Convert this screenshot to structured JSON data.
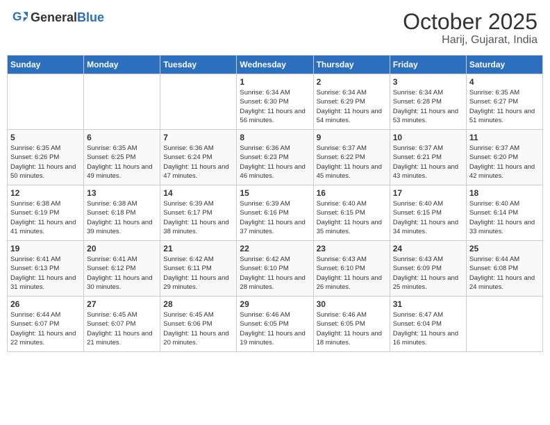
{
  "header": {
    "logo_general": "General",
    "logo_blue": "Blue",
    "main_title": "October 2025",
    "sub_title": "Harij, Gujarat, India"
  },
  "days_of_week": [
    "Sunday",
    "Monday",
    "Tuesday",
    "Wednesday",
    "Thursday",
    "Friday",
    "Saturday"
  ],
  "weeks": [
    [
      {
        "date": "",
        "sunrise": "",
        "sunset": "",
        "daylight": ""
      },
      {
        "date": "",
        "sunrise": "",
        "sunset": "",
        "daylight": ""
      },
      {
        "date": "",
        "sunrise": "",
        "sunset": "",
        "daylight": ""
      },
      {
        "date": "1",
        "sunrise": "Sunrise: 6:34 AM",
        "sunset": "Sunset: 6:30 PM",
        "daylight": "Daylight: 11 hours and 56 minutes."
      },
      {
        "date": "2",
        "sunrise": "Sunrise: 6:34 AM",
        "sunset": "Sunset: 6:29 PM",
        "daylight": "Daylight: 11 hours and 54 minutes."
      },
      {
        "date": "3",
        "sunrise": "Sunrise: 6:34 AM",
        "sunset": "Sunset: 6:28 PM",
        "daylight": "Daylight: 11 hours and 53 minutes."
      },
      {
        "date": "4",
        "sunrise": "Sunrise: 6:35 AM",
        "sunset": "Sunset: 6:27 PM",
        "daylight": "Daylight: 11 hours and 51 minutes."
      }
    ],
    [
      {
        "date": "5",
        "sunrise": "Sunrise: 6:35 AM",
        "sunset": "Sunset: 6:26 PM",
        "daylight": "Daylight: 11 hours and 50 minutes."
      },
      {
        "date": "6",
        "sunrise": "Sunrise: 6:35 AM",
        "sunset": "Sunset: 6:25 PM",
        "daylight": "Daylight: 11 hours and 49 minutes."
      },
      {
        "date": "7",
        "sunrise": "Sunrise: 6:36 AM",
        "sunset": "Sunset: 6:24 PM",
        "daylight": "Daylight: 11 hours and 47 minutes."
      },
      {
        "date": "8",
        "sunrise": "Sunrise: 6:36 AM",
        "sunset": "Sunset: 6:23 PM",
        "daylight": "Daylight: 11 hours and 46 minutes."
      },
      {
        "date": "9",
        "sunrise": "Sunrise: 6:37 AM",
        "sunset": "Sunset: 6:22 PM",
        "daylight": "Daylight: 11 hours and 45 minutes."
      },
      {
        "date": "10",
        "sunrise": "Sunrise: 6:37 AM",
        "sunset": "Sunset: 6:21 PM",
        "daylight": "Daylight: 11 hours and 43 minutes."
      },
      {
        "date": "11",
        "sunrise": "Sunrise: 6:37 AM",
        "sunset": "Sunset: 6:20 PM",
        "daylight": "Daylight: 11 hours and 42 minutes."
      }
    ],
    [
      {
        "date": "12",
        "sunrise": "Sunrise: 6:38 AM",
        "sunset": "Sunset: 6:19 PM",
        "daylight": "Daylight: 11 hours and 41 minutes."
      },
      {
        "date": "13",
        "sunrise": "Sunrise: 6:38 AM",
        "sunset": "Sunset: 6:18 PM",
        "daylight": "Daylight: 11 hours and 39 minutes."
      },
      {
        "date": "14",
        "sunrise": "Sunrise: 6:39 AM",
        "sunset": "Sunset: 6:17 PM",
        "daylight": "Daylight: 11 hours and 38 minutes."
      },
      {
        "date": "15",
        "sunrise": "Sunrise: 6:39 AM",
        "sunset": "Sunset: 6:16 PM",
        "daylight": "Daylight: 11 hours and 37 minutes."
      },
      {
        "date": "16",
        "sunrise": "Sunrise: 6:40 AM",
        "sunset": "Sunset: 6:15 PM",
        "daylight": "Daylight: 11 hours and 35 minutes."
      },
      {
        "date": "17",
        "sunrise": "Sunrise: 6:40 AM",
        "sunset": "Sunset: 6:15 PM",
        "daylight": "Daylight: 11 hours and 34 minutes."
      },
      {
        "date": "18",
        "sunrise": "Sunrise: 6:40 AM",
        "sunset": "Sunset: 6:14 PM",
        "daylight": "Daylight: 11 hours and 33 minutes."
      }
    ],
    [
      {
        "date": "19",
        "sunrise": "Sunrise: 6:41 AM",
        "sunset": "Sunset: 6:13 PM",
        "daylight": "Daylight: 11 hours and 31 minutes."
      },
      {
        "date": "20",
        "sunrise": "Sunrise: 6:41 AM",
        "sunset": "Sunset: 6:12 PM",
        "daylight": "Daylight: 11 hours and 30 minutes."
      },
      {
        "date": "21",
        "sunrise": "Sunrise: 6:42 AM",
        "sunset": "Sunset: 6:11 PM",
        "daylight": "Daylight: 11 hours and 29 minutes."
      },
      {
        "date": "22",
        "sunrise": "Sunrise: 6:42 AM",
        "sunset": "Sunset: 6:10 PM",
        "daylight": "Daylight: 11 hours and 28 minutes."
      },
      {
        "date": "23",
        "sunrise": "Sunrise: 6:43 AM",
        "sunset": "Sunset: 6:10 PM",
        "daylight": "Daylight: 11 hours and 26 minutes."
      },
      {
        "date": "24",
        "sunrise": "Sunrise: 6:43 AM",
        "sunset": "Sunset: 6:09 PM",
        "daylight": "Daylight: 11 hours and 25 minutes."
      },
      {
        "date": "25",
        "sunrise": "Sunrise: 6:44 AM",
        "sunset": "Sunset: 6:08 PM",
        "daylight": "Daylight: 11 hours and 24 minutes."
      }
    ],
    [
      {
        "date": "26",
        "sunrise": "Sunrise: 6:44 AM",
        "sunset": "Sunset: 6:07 PM",
        "daylight": "Daylight: 11 hours and 22 minutes."
      },
      {
        "date": "27",
        "sunrise": "Sunrise: 6:45 AM",
        "sunset": "Sunset: 6:07 PM",
        "daylight": "Daylight: 11 hours and 21 minutes."
      },
      {
        "date": "28",
        "sunrise": "Sunrise: 6:45 AM",
        "sunset": "Sunset: 6:06 PM",
        "daylight": "Daylight: 11 hours and 20 minutes."
      },
      {
        "date": "29",
        "sunrise": "Sunrise: 6:46 AM",
        "sunset": "Sunset: 6:05 PM",
        "daylight": "Daylight: 11 hours and 19 minutes."
      },
      {
        "date": "30",
        "sunrise": "Sunrise: 6:46 AM",
        "sunset": "Sunset: 6:05 PM",
        "daylight": "Daylight: 11 hours and 18 minutes."
      },
      {
        "date": "31",
        "sunrise": "Sunrise: 6:47 AM",
        "sunset": "Sunset: 6:04 PM",
        "daylight": "Daylight: 11 hours and 16 minutes."
      },
      {
        "date": "",
        "sunrise": "",
        "sunset": "",
        "daylight": ""
      }
    ]
  ]
}
